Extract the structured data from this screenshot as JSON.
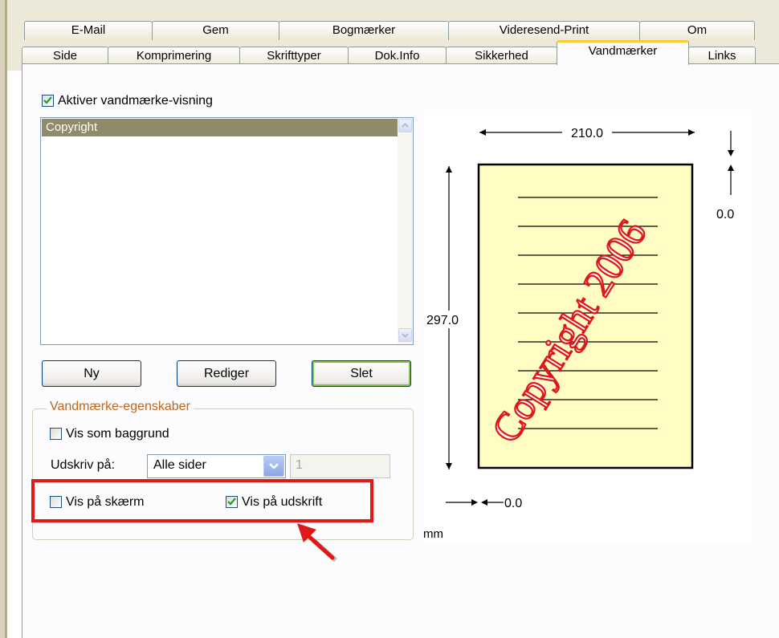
{
  "tabs_row1": [
    {
      "label": "E-Mail"
    },
    {
      "label": "Gem"
    },
    {
      "label": "Bogmærker"
    },
    {
      "label": "Videresend-Print"
    },
    {
      "label": "Om"
    }
  ],
  "tabs_row2": [
    {
      "label": "Side"
    },
    {
      "label": "Komprimering"
    },
    {
      "label": "Skrifttyper"
    },
    {
      "label": "Dok.Info"
    },
    {
      "label": "Sikkerhed"
    },
    {
      "label": "Vandmærker"
    },
    {
      "label": "Links"
    }
  ],
  "activate": {
    "label": "Aktiver vandmærke-visning",
    "checked": true
  },
  "watermark_list": {
    "items": [
      "Copyright"
    ],
    "selected": "Copyright"
  },
  "buttons": {
    "new": "Ny",
    "edit": "Rediger",
    "delete": "Slet"
  },
  "properties": {
    "title": "Vandmærke-egenskaber",
    "background": {
      "label": "Vis som baggrund",
      "checked": false
    },
    "print_on": {
      "label": "Udskriv på:",
      "value": "Alle sider",
      "page_field": "1"
    },
    "show_screen": {
      "label": "Vis på skærm",
      "checked": false
    },
    "show_print": {
      "label": "Vis på udskrift",
      "checked": true
    }
  },
  "preview": {
    "width_label": "210.0",
    "height_label": "297.0",
    "top_offset": "0.0",
    "left_offset": "0.0",
    "unit": "mm",
    "watermark_text": "Copyright 2006",
    "page_color": "#fffdc4",
    "watermark_color": "#e0141b"
  },
  "colors": {
    "highlight": "#e01818",
    "group_title": "#c0661c"
  }
}
